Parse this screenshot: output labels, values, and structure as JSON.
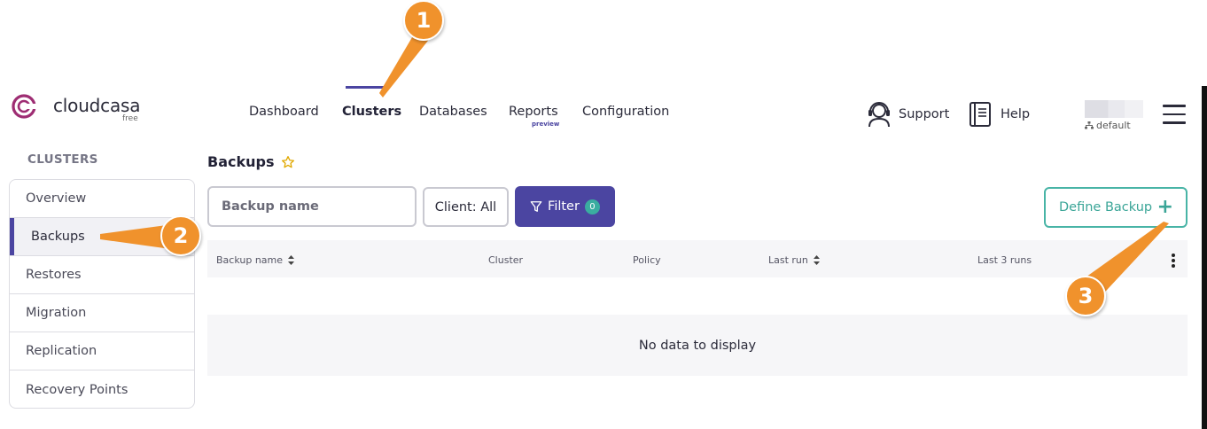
{
  "brand": {
    "name": "cloudcasa",
    "tier": "free",
    "accent": "#4b45a1",
    "logo_color": "#9e2d73"
  },
  "nav": {
    "items": [
      {
        "label": "Dashboard"
      },
      {
        "label": "Clusters",
        "active": true
      },
      {
        "label": "Databases"
      },
      {
        "label": "Reports",
        "tag": "preview"
      },
      {
        "label": "Configuration"
      }
    ]
  },
  "header_right": {
    "support_label": "Support",
    "support_icon": "headset-icon",
    "help_label": "Help",
    "help_icon": "book-icon",
    "tenant_label": "default",
    "menu_icon": "hamburger-icon"
  },
  "sidebar": {
    "title": "CLUSTERS",
    "items": [
      {
        "label": "Overview"
      },
      {
        "label": "Backups",
        "active": true
      },
      {
        "label": "Restores"
      },
      {
        "label": "Migration"
      },
      {
        "label": "Replication"
      },
      {
        "label": "Recovery Points"
      }
    ]
  },
  "main": {
    "title": "Backups",
    "favorite_icon": "star-outline-icon",
    "search_placeholder": "Backup name",
    "client_filter_label": "Client: All",
    "filter_label": "Filter",
    "filter_count": "0",
    "define_backup_label": "Define Backup",
    "define_backup_icon": "plus-icon",
    "table": {
      "columns": [
        "Backup name",
        "Cluster",
        "Policy",
        "Last run",
        "Last 3 runs"
      ],
      "sortable": [
        true,
        false,
        false,
        true,
        false
      ],
      "rows": [],
      "empty_message": "No data to display"
    },
    "accent_teal": "#48b4a6"
  },
  "annotations": {
    "markers": [
      "1",
      "2",
      "3"
    ],
    "color": "#f0922c"
  }
}
